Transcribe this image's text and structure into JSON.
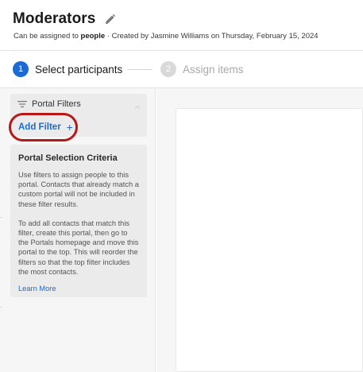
{
  "header": {
    "title": "Moderators",
    "subtitle_prefix": "Can be assigned to ",
    "subtitle_bold": "people",
    "subtitle_suffix": " · Created by Jasmine Williams on Thursday, February 15, 2024",
    "edit_icon": "pencil-icon"
  },
  "stepper": {
    "steps": [
      {
        "number": "1",
        "label": "Select participants",
        "state": "active"
      },
      {
        "number": "2",
        "label": "Assign items",
        "state": "inactive"
      }
    ]
  },
  "filters_card": {
    "title": "Portal Filters",
    "icon": "filter-icon",
    "add_label": "Add Filter",
    "add_icon": "plus-icon"
  },
  "criteria_card": {
    "title": "Portal Selection Criteria",
    "paragraph1": "Use filters to assign people to this portal. Contacts that already match a custom portal will not be included in these filter results.",
    "paragraph2": "To add all contacts that match this filter, create this portal, then go to the Portals homepage and move this portal to the top. This will reorder the filters so that the top filter includes the most contacts.",
    "link": "Learn More"
  },
  "colors": {
    "accent": "#1b6ad6",
    "highlight_annotation": "#b61818",
    "panel_bg": "#f6f6f6",
    "card_bg": "#ebebeb"
  }
}
